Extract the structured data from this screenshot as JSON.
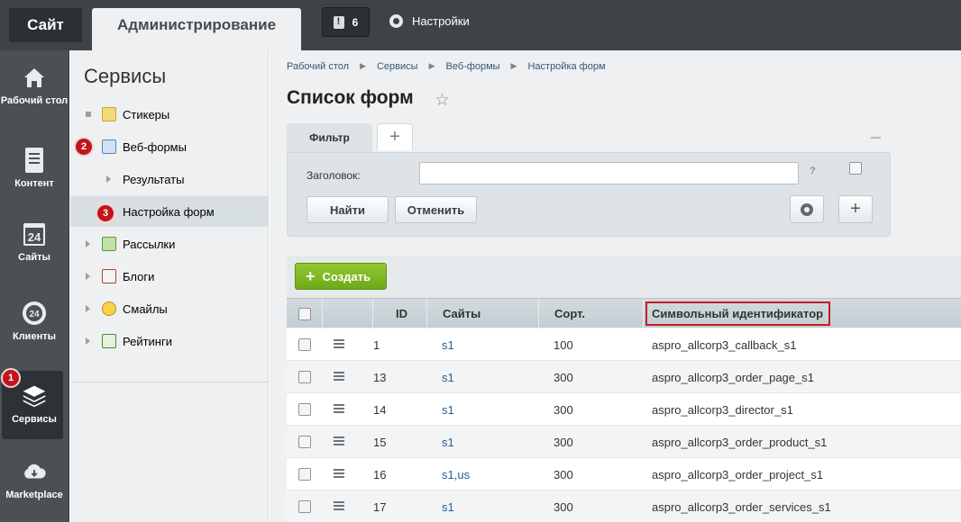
{
  "topbar": {
    "site_tab": "Сайт",
    "admin_tab": "Администрирование",
    "notifications_count": "6",
    "settings_label": "Настройки"
  },
  "left_menu": {
    "items": [
      {
        "label": "Рабочий стол",
        "icon": "home-icon"
      },
      {
        "label": "Контент",
        "icon": "document-icon"
      },
      {
        "label": "Сайты",
        "icon": "calendar-icon"
      },
      {
        "label": "Клиенты",
        "icon": "clients-icon"
      },
      {
        "label": "Сервисы",
        "icon": "layers-icon",
        "active": true
      },
      {
        "label": "Marketplace",
        "icon": "cloud-icon"
      }
    ]
  },
  "services": {
    "title": "Сервисы",
    "items": [
      {
        "label": "Стикеры"
      },
      {
        "label": "Веб-формы"
      },
      {
        "label": "Результаты"
      },
      {
        "label": "Настройка форм",
        "selected": true
      },
      {
        "label": "Рассылки"
      },
      {
        "label": "Блоги"
      },
      {
        "label": "Смайлы"
      },
      {
        "label": "Рейтинги"
      }
    ]
  },
  "badges": {
    "b1": "1",
    "b2": "2",
    "b3": "3"
  },
  "breadcrumbs": [
    "Рабочий стол",
    "Сервисы",
    "Веб-формы",
    "Настройка форм"
  ],
  "page_title": "Список форм",
  "filter": {
    "tab_label": "Фильтр",
    "field_label": "Заголовок:",
    "field_value": "",
    "help": "?",
    "find_button": "Найти",
    "cancel_button": "Отменить"
  },
  "create_button": "Создать",
  "table": {
    "headers": {
      "id": "ID",
      "sites": "Сайты",
      "sort": "Сорт.",
      "code": "Символьный идентификатор"
    },
    "rows": [
      {
        "id": "1",
        "sites": "s1",
        "sort": "100",
        "code": "aspro_allcorp3_callback_s1"
      },
      {
        "id": "13",
        "sites": "s1",
        "sort": "300",
        "code": "aspro_allcorp3_order_page_s1"
      },
      {
        "id": "14",
        "sites": "s1",
        "sort": "300",
        "code": "aspro_allcorp3_director_s1"
      },
      {
        "id": "15",
        "sites": "s1",
        "sort": "300",
        "code": "aspro_allcorp3_order_product_s1"
      },
      {
        "id": "16",
        "sites": "s1,us",
        "sort": "300",
        "code": "aspro_allcorp3_order_project_s1"
      },
      {
        "id": "17",
        "sites": "s1",
        "sort": "300",
        "code": "aspro_allcorp3_order_services_s1"
      }
    ]
  },
  "colors": {
    "accent_green": "#7cb826",
    "badge_red": "#c1151b",
    "link_blue": "#2a5d91"
  }
}
